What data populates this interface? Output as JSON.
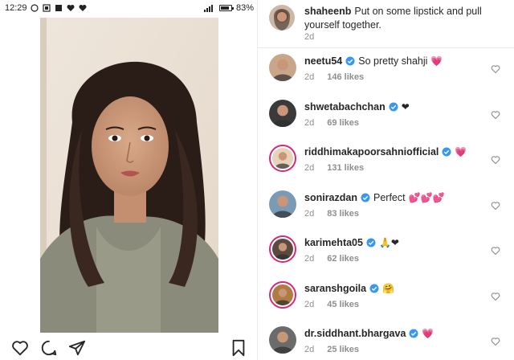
{
  "status_bar": {
    "time": "12:29",
    "battery": "83%",
    "battery_fraction": 0.83
  },
  "post": {
    "caption": {
      "username": "shaheenb",
      "text": "Put on some lipstick and pull yourself together.",
      "time": "2d"
    }
  },
  "comments": [
    {
      "username": "neetu54",
      "verified": true,
      "text": "So pretty shahji",
      "emoji": "💗",
      "time": "2d",
      "likes": "146 likes"
    },
    {
      "username": "shwetabachchan",
      "verified": true,
      "text": "",
      "emoji": "❤",
      "time": "2d",
      "likes": "69 likes"
    },
    {
      "username": "riddhimakapoorsahniofficial",
      "verified": true,
      "text": "",
      "emoji": "💗",
      "time": "2d",
      "likes": "131 likes"
    },
    {
      "username": "sonirazdan",
      "verified": true,
      "text": "Perfect",
      "emoji": "💕💕💕",
      "time": "2d",
      "likes": "83 likes"
    },
    {
      "username": "karimehta05",
      "verified": true,
      "text": "",
      "emoji": "🙏❤",
      "time": "2d",
      "likes": "62 likes"
    },
    {
      "username": "saranshgoila",
      "verified": true,
      "text": "",
      "emoji": "🤗",
      "time": "2d",
      "likes": "45 likes"
    },
    {
      "username": "dr.siddhant.bhargava",
      "verified": true,
      "text": "",
      "emoji": "💗",
      "time": "2d",
      "likes": "25 likes"
    }
  ],
  "colors": {
    "verified": "#3897f0",
    "story_ring": "#d62976",
    "meta_gray": "#8e8e8e"
  },
  "icons": {
    "like": "heart-outline-icon",
    "comment": "comment-bubble-icon",
    "share": "paper-plane-icon",
    "save": "bookmark-icon",
    "comment_like": "small-heart-outline-icon",
    "verified": "verified-badge-icon"
  }
}
